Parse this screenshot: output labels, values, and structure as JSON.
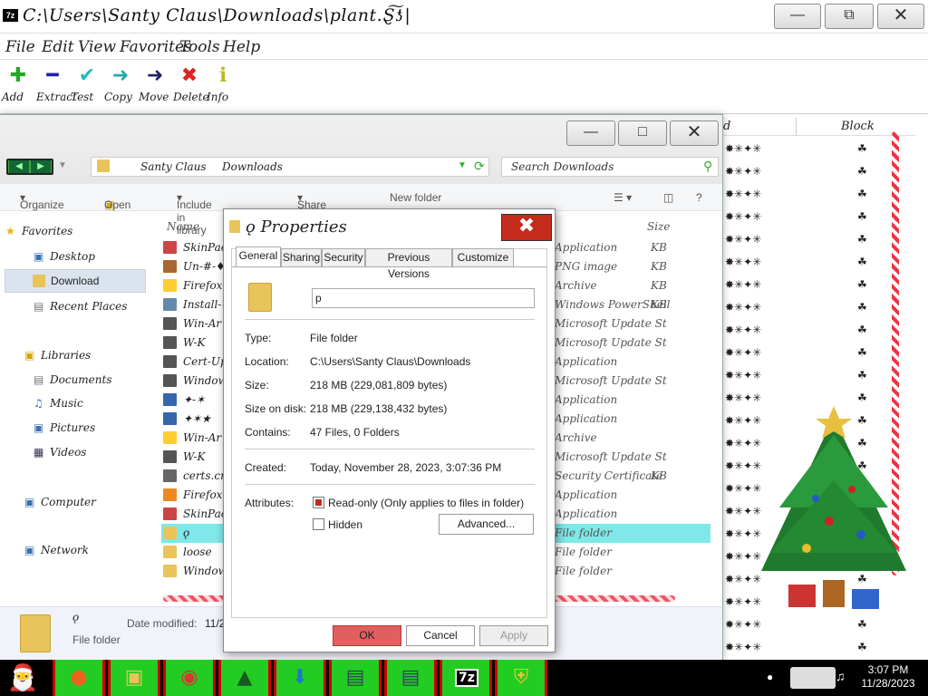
{
  "zip": {
    "title": "C:\\Users\\Santy Claus\\Downloads\\plant.Ȿ͠ƾ|",
    "logo": "7z",
    "menu": [
      "File",
      "Edit",
      "View",
      "Favorites",
      "Tools",
      "Help"
    ],
    "toolbar": [
      {
        "icon": "plus-icon",
        "glyph": "✚",
        "label": "Add",
        "color": "#2a2"
      },
      {
        "icon": "minus-icon",
        "glyph": "━",
        "label": "Extract",
        "color": "#22a"
      },
      {
        "icon": "check-icon",
        "glyph": "✔",
        "label": "Test",
        "color": "#2bb"
      },
      {
        "icon": "copy-arrow-icon",
        "glyph": "➜",
        "label": "Copy",
        "color": "#2aa"
      },
      {
        "icon": "move-arrow-icon",
        "glyph": "➜",
        "label": "Move",
        "color": "#226"
      },
      {
        "icon": "delete-x-icon",
        "glyph": "✖",
        "label": "Delete",
        "color": "#d22"
      },
      {
        "icon": "info-icon",
        "glyph": "ℹ",
        "label": "Info",
        "color": "#bb2"
      }
    ],
    "list_header": {
      "name_tail": "d",
      "block": "Block"
    },
    "list_rows": 23
  },
  "explorer": {
    "address": [
      "Santy Claus",
      "Downloads"
    ],
    "search_placeholder": "Search Downloads",
    "commands": {
      "organize": "Organize",
      "open": "Open",
      "include": "Include in library",
      "share": "Share with",
      "new_folder": "New folder"
    },
    "nav": {
      "favorites": "Favorites",
      "desktop": "Desktop",
      "download": "Download",
      "recent": "Recent Places",
      "libraries": "Libraries",
      "documents": "Documents",
      "music": "Music",
      "pictures": "Pictures",
      "videos": "Videos",
      "computer": "Computer",
      "network": "Network"
    },
    "columns": {
      "name": "Name",
      "size": "Size"
    },
    "files": [
      {
        "name": "SkinPack",
        "type": "Application",
        "size": "KB",
        "color": "#c44"
      },
      {
        "name": "Un-#-♦",
        "type": "PNG image",
        "size": "KB",
        "color": "#a63"
      },
      {
        "name": "Firefox-U",
        "type": "Archive",
        "size": "KB",
        "color": "#fc3"
      },
      {
        "name": "Install-U",
        "type": "Windows PowerShell",
        "size": "KB",
        "color": "#68a"
      },
      {
        "name": "Win-Ar",
        "type": "Microsoft Update St",
        "size": "",
        "color": "#555"
      },
      {
        "name": "W-K",
        "type": "Microsoft Update St",
        "size": "",
        "color": "#555"
      },
      {
        "name": "Cert-Upd",
        "type": "Application",
        "size": "",
        "color": "#555"
      },
      {
        "name": "Windows",
        "type": "Microsoft Update St",
        "size": "",
        "color": "#555"
      },
      {
        "name": "✦-✶",
        "type": "Application",
        "size": "",
        "color": "#36a"
      },
      {
        "name": "✦✶★",
        "type": "Application",
        "size": "",
        "color": "#36a"
      },
      {
        "name": "Win-Ar",
        "type": "Archive",
        "size": "",
        "color": "#fc3"
      },
      {
        "name": "W-K",
        "type": "Microsoft Update St",
        "size": "",
        "color": "#555"
      },
      {
        "name": "certs.crt",
        "type": "Security Certificate",
        "size": "KB",
        "color": "#666"
      },
      {
        "name": "Firefox S",
        "type": "Application",
        "size": "",
        "color": "#e82"
      },
      {
        "name": "SkinPack",
        "type": "Application",
        "size": "",
        "color": "#c44"
      },
      {
        "name": "ǫ",
        "type": "File folder",
        "size": "",
        "color": "#e8c45a",
        "selected": true
      },
      {
        "name": "loose",
        "type": "File folder",
        "size": "",
        "color": "#e8c45a"
      },
      {
        "name": "Windows",
        "type": "File folder",
        "size": "",
        "color": "#e8c45a"
      }
    ],
    "details": {
      "name": "ǫ",
      "kind": "File folder",
      "modified_label": "Date modified:",
      "modified_value": "11/2"
    }
  },
  "dialog": {
    "title": "ǫ Properties",
    "tabs": [
      "General",
      "Sharing",
      "Security",
      "Previous Versions",
      "Customize"
    ],
    "name_value": "p",
    "rows": [
      {
        "label": "Type:",
        "value": "File folder"
      },
      {
        "label": "Location:",
        "value": "C:\\Users\\Santy Claus\\Downloads"
      },
      {
        "label": "Size:",
        "value": "218 MB (229,081,809 bytes)"
      },
      {
        "label": "Size on disk:",
        "value": "218 MB (229,138,432 bytes)"
      },
      {
        "label": "Contains:",
        "value": "47 Files, 0 Folders"
      },
      {
        "label": "Created:",
        "value": "Today, November 28, 2023, 3:07:36 PM"
      }
    ],
    "attributes_label": "Attributes:",
    "readonly": "Read-only (Only applies to files in folder)",
    "hidden": "Hidden",
    "advanced": "Advanced...",
    "ok": "OK",
    "cancel": "Cancel",
    "apply": "Apply"
  },
  "taskbar": {
    "apps": [
      "santa-start-icon",
      "firefox-icon",
      "file-explorer-icon",
      "chrome-icon",
      "tree-icon",
      "download-icon",
      "network-setup-icon",
      "network-setup-icon",
      "7zip-icon",
      "shield-icon"
    ],
    "time": "3:07 PM",
    "date": "11/28/2023"
  }
}
